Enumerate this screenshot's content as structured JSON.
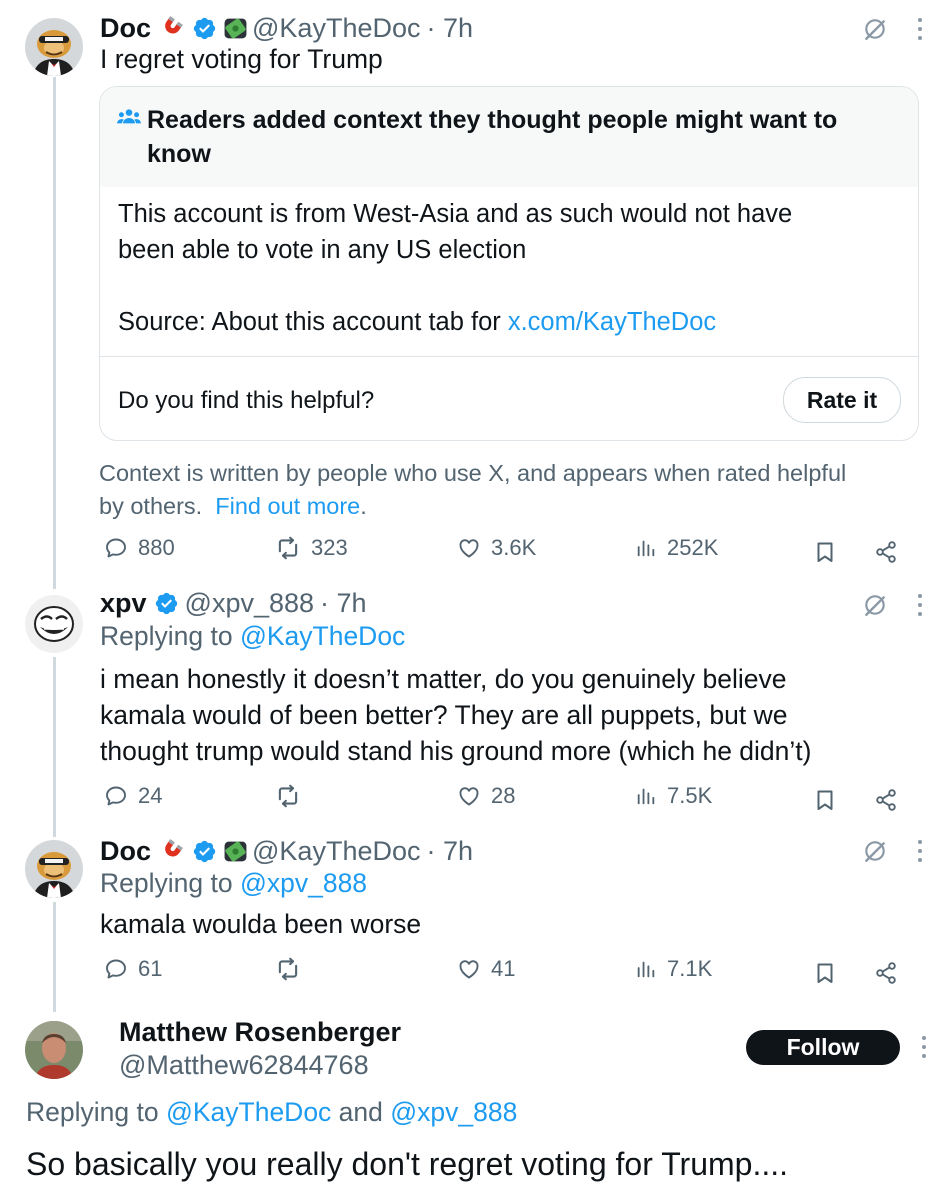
{
  "tweet1": {
    "name": "Doc",
    "handle": "@KayTheDoc",
    "time": "· 7h",
    "text": "I regret voting for Trump",
    "note": {
      "header": "Readers added context they thought people might want to",
      "header_line2": "know",
      "body_line1": "This account is from West-Asia and as such would not have",
      "body_line2": "been able to vote in any US election",
      "source_prefix": "Source: About this account tab for ",
      "source_link": "x.com/KayTheDoc",
      "helpful_question": "Do you find this helpful?",
      "rate_label": "Rate it",
      "footer_line1": "Context is written by people who use X, and appears when rated helpful",
      "footer_line2": "by others.",
      "find_out": "Find out more",
      "period": "."
    },
    "stats": {
      "replies": "880",
      "reposts": "323",
      "likes": "3.6K",
      "views": "252K"
    }
  },
  "tweet2": {
    "name": "xpv",
    "handle": "@xpv_888",
    "time": "· 7h",
    "replying_prefix": "Replying to ",
    "replying_to": "@KayTheDoc",
    "line1": "i mean honestly it doesn’t matter, do you genuinely believe",
    "line2": "kamala would of been better? They are all puppets, but we",
    "line3": "thought trump would stand his ground more (which he didn’t)",
    "stats": {
      "replies": "24",
      "reposts": "",
      "likes": "28",
      "views": "7.5K"
    }
  },
  "tweet3": {
    "name": "Doc",
    "handle": "@KayTheDoc",
    "time": "· 7h",
    "replying_prefix": "Replying to ",
    "replying_to": "@xpv_888",
    "text": "kamala woulda been worse",
    "stats": {
      "replies": "61",
      "reposts": "",
      "likes": "41",
      "views": "7.1K"
    }
  },
  "tweet4": {
    "name": "Matthew Rosenberger",
    "handle": "@Matthew62844768",
    "follow_label": "Follow",
    "replying_prefix": "Replying to ",
    "replying_to_1": "@KayTheDoc",
    "replying_and": " and ",
    "replying_to_2": "@xpv_888",
    "text": "So basically you really don't regret voting for Trump...."
  },
  "icons": {
    "verified": "verified-badge-icon",
    "magnet": "magnet-emoji-icon",
    "money": "money-emoji-icon",
    "grok": "grok-icon",
    "more": "more-icon",
    "reply": "reply-icon",
    "repost": "repost-icon",
    "like": "like-icon",
    "views": "views-icon",
    "bookmark": "bookmark-icon",
    "share": "share-icon",
    "community": "community-notes-icon"
  },
  "colors": {
    "accent": "#1d9bf0",
    "text": "#0f1419",
    "secondary": "#536471",
    "border": "#dfe4e8"
  }
}
